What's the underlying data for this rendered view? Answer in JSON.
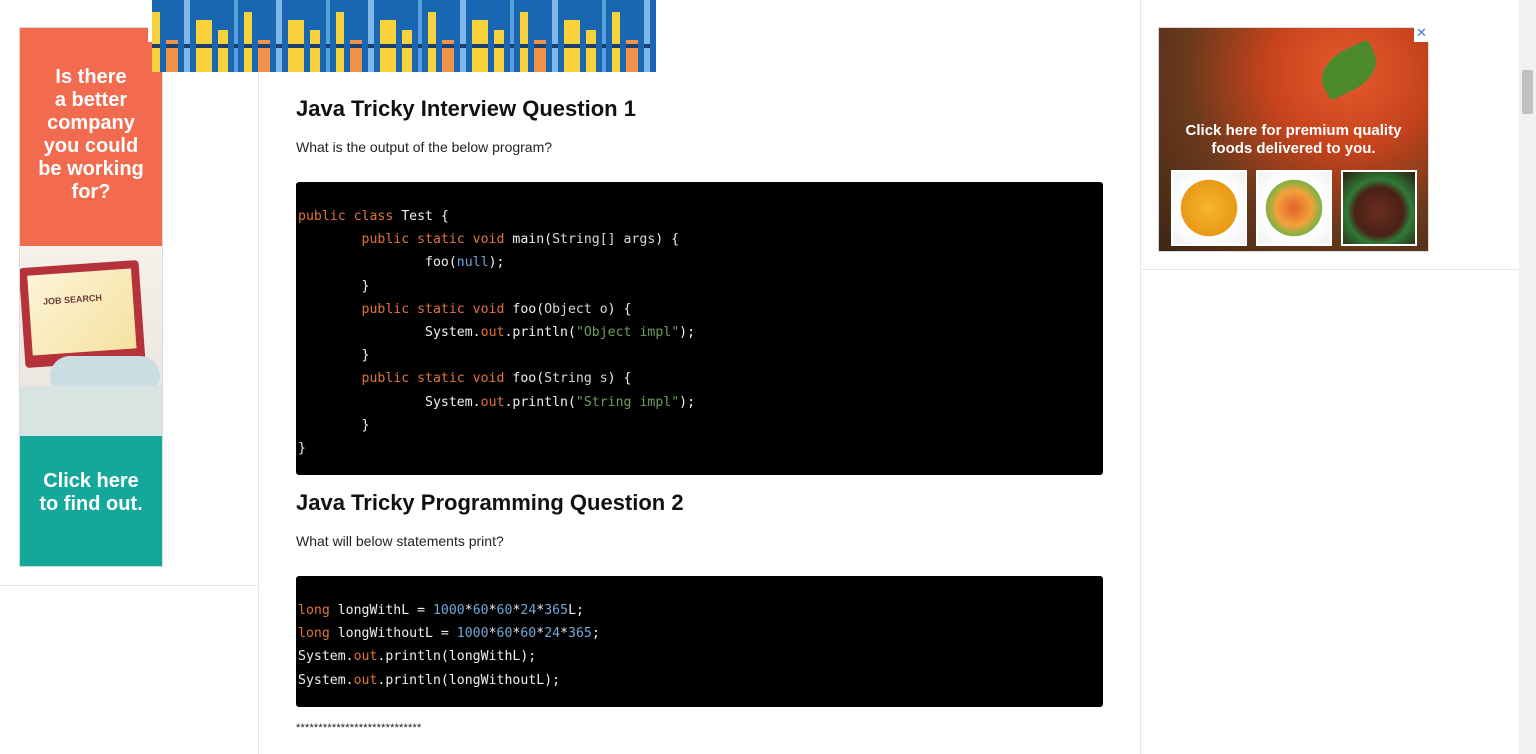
{
  "left_ad": {
    "headline_lines": [
      "Is there",
      "a better",
      "company",
      "you could",
      "be working",
      "for?"
    ],
    "laptop_label": "JOB SEARCH",
    "cta_lines": [
      "Click here",
      "to find out."
    ],
    "close_glyph": "✕"
  },
  "right_ad": {
    "tagline_lines": [
      "Click here for premium quality",
      "foods delivered to you."
    ],
    "close_glyph": "✕"
  },
  "question1": {
    "title": "Java Tricky Interview Question 1",
    "prompt": "What is the output of the below program?"
  },
  "question2": {
    "title": "Java Tricky Programming Question 2",
    "prompt": "What will below statements print?"
  },
  "code1": [
    [
      {
        "t": "public class ",
        "c": "kw"
      },
      {
        "t": "Test {",
        "c": "fn"
      }
    ],
    [
      {
        "t": "        public static void ",
        "c": "kw"
      },
      {
        "t": "main(",
        "c": "fn"
      },
      {
        "t": "String[] args",
        "c": "cls"
      },
      {
        "t": ") {",
        "c": "fn"
      }
    ],
    [
      {
        "t": "                foo(",
        "c": "fn"
      },
      {
        "t": "null",
        "c": "lit"
      },
      {
        "t": ");",
        "c": "fn"
      }
    ],
    [
      {
        "t": "        }",
        "c": "fn"
      }
    ],
    [
      {
        "t": "        public static void ",
        "c": "kw"
      },
      {
        "t": "foo(",
        "c": "fn"
      },
      {
        "t": "Object o",
        "c": "cls"
      },
      {
        "t": ") {",
        "c": "fn"
      }
    ],
    [
      {
        "t": "                System.",
        "c": "fn"
      },
      {
        "t": "out",
        "c": "kw"
      },
      {
        "t": ".println(",
        "c": "fn"
      },
      {
        "t": "\"Object impl\"",
        "c": "str"
      },
      {
        "t": ");",
        "c": "fn"
      }
    ],
    [
      {
        "t": "        }",
        "c": "fn"
      }
    ],
    [
      {
        "t": "        public static void ",
        "c": "kw"
      },
      {
        "t": "foo(",
        "c": "fn"
      },
      {
        "t": "String s",
        "c": "cls"
      },
      {
        "t": ") {",
        "c": "fn"
      }
    ],
    [
      {
        "t": "                System.",
        "c": "fn"
      },
      {
        "t": "out",
        "c": "kw"
      },
      {
        "t": ".println(",
        "c": "fn"
      },
      {
        "t": "\"String impl\"",
        "c": "str"
      },
      {
        "t": ");",
        "c": "fn"
      }
    ],
    [
      {
        "t": "        }",
        "c": "fn"
      }
    ],
    [
      {
        "t": "}",
        "c": "fn"
      }
    ]
  ],
  "code2": [
    [
      {
        "t": "long ",
        "c": "kw"
      },
      {
        "t": "longWithL = ",
        "c": "fn"
      },
      {
        "t": "1000",
        "c": "num"
      },
      {
        "t": "*",
        "c": "fn"
      },
      {
        "t": "60",
        "c": "num"
      },
      {
        "t": "*",
        "c": "fn"
      },
      {
        "t": "60",
        "c": "num"
      },
      {
        "t": "*",
        "c": "fn"
      },
      {
        "t": "24",
        "c": "num"
      },
      {
        "t": "*",
        "c": "fn"
      },
      {
        "t": "365",
        "c": "num"
      },
      {
        "t": "L;",
        "c": "fn"
      }
    ],
    [
      {
        "t": "long ",
        "c": "kw"
      },
      {
        "t": "longWithoutL = ",
        "c": "fn"
      },
      {
        "t": "1000",
        "c": "num"
      },
      {
        "t": "*",
        "c": "fn"
      },
      {
        "t": "60",
        "c": "num"
      },
      {
        "t": "*",
        "c": "fn"
      },
      {
        "t": "60",
        "c": "num"
      },
      {
        "t": "*",
        "c": "fn"
      },
      {
        "t": "24",
        "c": "num"
      },
      {
        "t": "*",
        "c": "fn"
      },
      {
        "t": "365",
        "c": "num"
      },
      {
        "t": ";",
        "c": "fn"
      }
    ],
    [
      {
        "t": "System.",
        "c": "fn"
      },
      {
        "t": "out",
        "c": "kw"
      },
      {
        "t": ".println(longWithL);",
        "c": "fn"
      }
    ],
    [
      {
        "t": "System.",
        "c": "fn"
      },
      {
        "t": "out",
        "c": "kw"
      },
      {
        "t": ".println(longWithoutL);",
        "c": "fn"
      }
    ]
  ],
  "separator": "****************************",
  "colors": {
    "left_ad_top": "#f26b4f",
    "left_ad_bottom": "#14a89a",
    "banner_bg": "#1967b3",
    "code_bg": "#000000"
  }
}
